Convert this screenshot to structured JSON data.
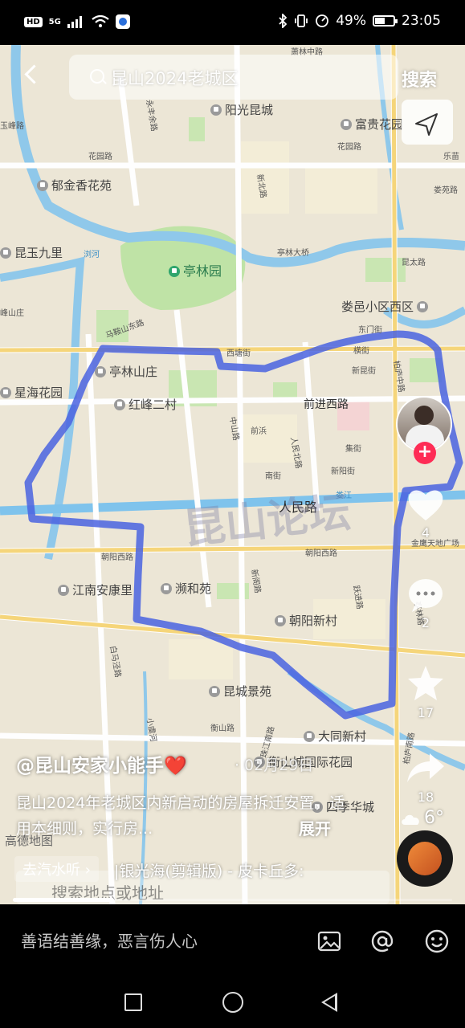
{
  "status_bar": {
    "hd_badge": "HD",
    "network": "5G",
    "battery_percent": "49%",
    "time": "23:05",
    "battery_level": 0.49
  },
  "top_bar": {
    "search_text": "昆山2024老城区",
    "search_button": "搜索"
  },
  "map": {
    "watermark": "昆山论坛",
    "logo": "高德地图",
    "labels": [
      "萧林中路",
      "阳光昆城",
      "富贵花园",
      "永丰余路",
      "花园路",
      "花园路",
      "新北路",
      "郁金香花苑",
      "乐苗",
      "娄苑路",
      "昆玉九里",
      "浏河",
      "亭林园",
      "亭林大桥",
      "昆太路",
      "娄邑小区西区",
      "马鞍山东路",
      "西塘街",
      "东门街",
      "横街",
      "亭林山庄",
      "新昆街",
      "柏庐中路",
      "星海花园",
      "红峰二村",
      "前进西路",
      "中山路",
      "前浜",
      "人民北路",
      "集街",
      "新阳街",
      "南街",
      "娄江",
      "人民路",
      "朝阳西路",
      "朝阳西路",
      "江南安康里",
      "濒和苑",
      "新阁路",
      "跃进路",
      "朝阳新村",
      "白马泾路",
      "昆城景苑",
      "小虞河",
      "衡山路",
      "珠江南路",
      "大同新村",
      "衡山城国际花园",
      "四季华城",
      "柏庐南路",
      "金鹰天地广场",
      "亭林路",
      "峰山庄",
      "玉峰路"
    ],
    "route_color": "#4a63e0"
  },
  "actions": {
    "likes": "4",
    "comments": "2",
    "favorites": "17",
    "shares": "18",
    "weather": "6°"
  },
  "post": {
    "author": "@昆山安家小能手",
    "author_emoji": "❤️",
    "date": "· 02月29日",
    "caption": "昆山2024年老城区内新启动的房屋拆迁安置，适用本细则，实行房...",
    "expand": "展开",
    "music_chip": "去汽水听 ›",
    "music_title": "|银光海(剪辑版) - 皮卡丘多:",
    "map_search_placeholder": "搜索地点或地址",
    "progress": 0.23
  },
  "comment_bar": {
    "placeholder": "善语结善缘，恶言伤人心"
  },
  "icons": {
    "back": "chevron-left-icon",
    "search": "search-icon",
    "map_book": "map-book-icon",
    "locate": "navigation-arrow-icon",
    "image": "image-icon",
    "mention": "at-icon",
    "emoji": "emoji-icon"
  }
}
